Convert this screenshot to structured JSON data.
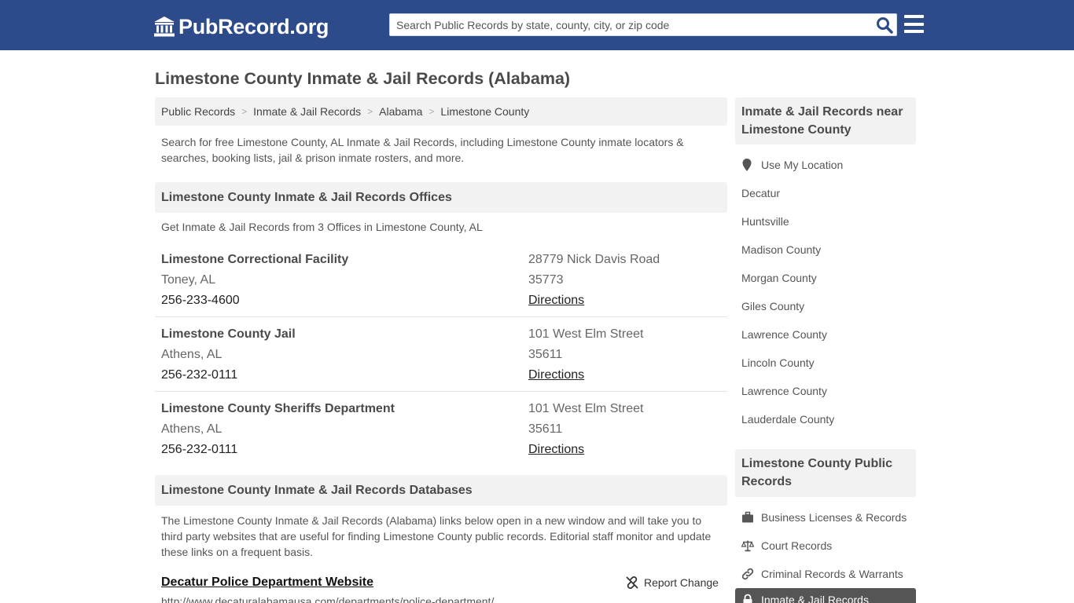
{
  "header": {
    "logo_text": "PubRecord.org",
    "search_placeholder": "Search Public Records by state, county, city, or zip code",
    "icons": {
      "logo": "building-columns-icon",
      "search": "search-icon",
      "menu": "hamburger-icon"
    }
  },
  "page": {
    "title": "Limestone County Inmate & Jail Records (Alabama)",
    "breadcrumb": [
      "Public Records",
      "Inmate & Jail Records",
      "Alabama",
      "Limestone County"
    ],
    "intro": "Search for free Limestone County, AL Inmate & Jail Records, including Limestone County inmate locators & searches, booking lists, jail & prison inmate rosters, and more."
  },
  "offices": {
    "heading": "Limestone County Inmate & Jail Records Offices",
    "subtext": "Get Inmate & Jail Records from 3 Offices in Limestone County, AL",
    "items": [
      {
        "name": "Limestone Correctional Facility",
        "city": "Toney, AL",
        "phone": "256-233-4600",
        "street": "28779 Nick Davis Road",
        "zip": "35773",
        "directions": "Directions"
      },
      {
        "name": "Limestone County Jail",
        "city": "Athens, AL",
        "phone": "256-232-0111",
        "street": "101 West Elm Street",
        "zip": "35611",
        "directions": "Directions"
      },
      {
        "name": "Limestone County Sheriffs Department",
        "city": "Athens, AL",
        "phone": "256-232-0111",
        "street": "101 West Elm Street",
        "zip": "35611",
        "directions": "Directions"
      }
    ]
  },
  "databases": {
    "heading": "Limestone County Inmate & Jail Records Databases",
    "text": "The Limestone County Inmate & Jail Records (Alabama) links below open in a new window and will take you to third party websites that are useful for finding Limestone County public records. Editorial staff monitor and update these links on a frequent basis.",
    "first_link": "Decatur Police Department Website",
    "first_url": "http://www.decaturalabamausa.com/departments/police-department/",
    "report_label": "Report Change"
  },
  "sidebar": {
    "near_heading": "Inmate & Jail Records near Limestone County",
    "use_location": "Use My Location",
    "near_items": [
      "Decatur",
      "Huntsville",
      "Madison County",
      "Morgan County",
      "Giles County",
      "Lawrence County",
      "Lincoln County",
      "Lawrence County",
      "Lauderdale County"
    ],
    "public_heading": "Limestone County Public Records",
    "public_items": [
      {
        "label": "Business Licenses & Records",
        "icon": "briefcase-icon"
      },
      {
        "label": "Court Records",
        "icon": "scale-icon"
      },
      {
        "label": "Criminal Records & Warrants",
        "icon": "link-icon"
      }
    ],
    "public_active": {
      "label": "Inmate & Jail Records",
      "icon": "lock-icon"
    }
  },
  "colors": {
    "header_bg": "#2d4b8b",
    "panel_bg": "#f2f2f2",
    "active_bg": "#555555"
  }
}
